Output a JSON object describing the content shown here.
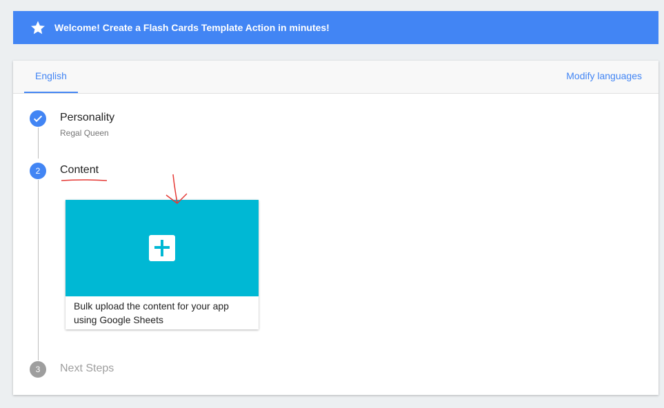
{
  "banner": {
    "message": "Welcome! Create a Flash Cards Template Action in minutes!",
    "icon": "star-icon",
    "color": "#4285f4"
  },
  "tabs": {
    "active_label": "English",
    "modify_label": "Modify languages"
  },
  "steps": [
    {
      "number": "1",
      "title": "Personality",
      "subtitle": "Regal Queen",
      "state": "completed",
      "icon": "check-icon"
    },
    {
      "number": "2",
      "title": "Content",
      "state": "active"
    },
    {
      "number": "3",
      "title": "Next Steps",
      "state": "inactive"
    }
  ],
  "upload_card": {
    "text": "Bulk upload the content for your app using Google Sheets",
    "icon": "add-icon",
    "hero_color": "#00b8d4"
  },
  "colors": {
    "accent": "#4285f4",
    "inactive": "#9e9e9e",
    "annotation": "#e53935"
  }
}
